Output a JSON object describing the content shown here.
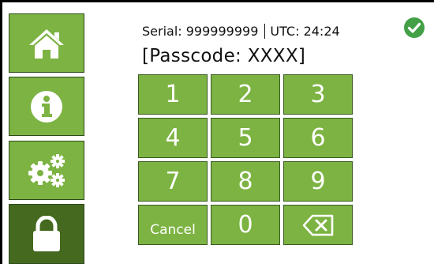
{
  "header": {
    "serial_label": "Serial: 999999999",
    "utc_label": "UTC: 24:24",
    "passcode": "[Passcode: XXXX]",
    "status_icon": "check-circle-icon"
  },
  "sidebar": {
    "items": [
      {
        "name": "home",
        "icon": "home-icon",
        "active": false
      },
      {
        "name": "info",
        "icon": "info-icon",
        "active": false
      },
      {
        "name": "settings",
        "icon": "gears-icon",
        "active": false
      },
      {
        "name": "lock",
        "icon": "lock-icon",
        "active": true
      }
    ]
  },
  "keypad": {
    "keys": [
      "1",
      "2",
      "3",
      "4",
      "5",
      "6",
      "7",
      "8",
      "9"
    ],
    "cancel_label": "Cancel",
    "zero": "0",
    "backspace_icon": "backspace-icon"
  },
  "colors": {
    "button_green": "#7cb342",
    "active_green": "#44691f",
    "status_green": "#43a047"
  }
}
